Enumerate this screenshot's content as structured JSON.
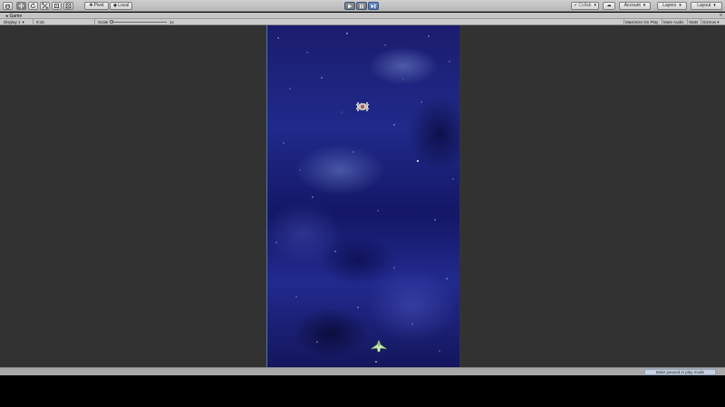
{
  "toolbar": {
    "tools": [
      {
        "name": "hand",
        "icon": "hand-icon"
      },
      {
        "name": "move",
        "icon": "move-icon"
      },
      {
        "name": "rotate",
        "icon": "rotate-icon"
      },
      {
        "name": "scale",
        "icon": "scale-icon"
      },
      {
        "name": "rect",
        "icon": "rect-tool-icon"
      },
      {
        "name": "transform",
        "icon": "transform-icon"
      }
    ],
    "pivot_label": "Pivot",
    "local_label": "Local",
    "collab_label": "Collab",
    "account_label": "Account",
    "layers_label": "Layers",
    "layout_label": "Layout",
    "accent": "#4a6ea6"
  },
  "tab": {
    "label": "Game",
    "icon": "game-controller-icon",
    "menu_glyph": "≡"
  },
  "gamebar": {
    "display": "Display 1",
    "aspect": "9:16",
    "scale_label": "Scale",
    "scale_value": "1x",
    "maximize": "Maximize On Play",
    "mute": "Mute Audio",
    "stats": "Stats",
    "gizmos": "Gizmos"
  },
  "status": {
    "message": "Bake paused in play mode",
    "highlight": "#c9d1de"
  },
  "game": {
    "background": "#1b1c6e",
    "enemy": "enemy-ship",
    "player": "player-ship"
  }
}
